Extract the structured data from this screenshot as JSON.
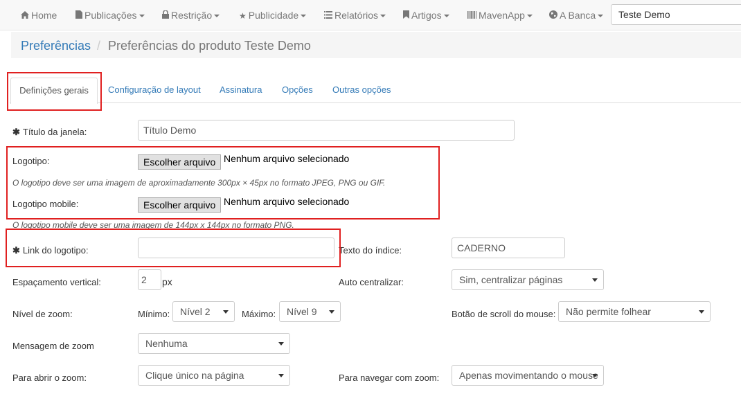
{
  "nav": {
    "home": "Home",
    "publicacoes": "Publicações",
    "restricao": "Restrição",
    "publicidade": "Publicidade",
    "relatorios": "Relatórios",
    "artigos": "Artigos",
    "mavenapp": "MavenApp",
    "abanca": "A Banca",
    "selected_pub": "Teste Demo"
  },
  "breadcrumb": {
    "link": "Preferências",
    "separator": "/",
    "current": "Preferências do produto Teste Demo"
  },
  "tabs": [
    {
      "label": "Definições gerais",
      "active": true
    },
    {
      "label": "Configuração de layout"
    },
    {
      "label": "Assinatura"
    },
    {
      "label": "Opções"
    },
    {
      "label": "Outras opções"
    }
  ],
  "form": {
    "titulo_label": "Título da janela:",
    "titulo_value": "Título Demo",
    "logotipo_label": "Logotipo:",
    "file_button": "Escolher arquivo",
    "no_file": "Nenhum arquivo selecionado",
    "logotipo_help": "O logotipo deve ser uma imagem de aproximadamente 300px × 45px no formato JPEG, PNG ou GIF.",
    "logotipo_mobile_label": "Logotipo mobile:",
    "logotipo_mobile_help": "O logotipo mobile deve ser uma imagem de 144px x 144px no formato PNG.",
    "link_logotipo_label": "Link do logotipo:",
    "link_logotipo_value": "",
    "texto_indice_label": "Texto do índice:",
    "texto_indice_value": "CADERNO",
    "espacamento_label": "Espaçamento vertical:",
    "espacamento_value": "2",
    "espacamento_unit": "px",
    "auto_centralizar_label": "Auto centralizar:",
    "auto_centralizar_value": "Sim, centralizar páginas",
    "nivel_zoom_label": "Nível de zoom:",
    "minimo_label": "Mínimo:",
    "minimo_value": "Nível 2",
    "maximo_label": "Máximo:",
    "maximo_value": "Nível 9",
    "scroll_label": "Botão de scroll do mouse:",
    "scroll_value": "Não permite folhear",
    "mensagem_zoom_label": "Mensagem de zoom",
    "mensagem_zoom_value": "Nenhuma",
    "abrir_zoom_label": "Para abrir o zoom:",
    "abrir_zoom_value": "Clique único na página",
    "navegar_zoom_label": "Para navegar com zoom:",
    "navegar_zoom_value": "Apenas movimentando o mouse"
  },
  "colors": {
    "link": "#337ab7",
    "highlight": "#e02020"
  },
  "icons": {
    "home": "home-icon",
    "publicacoes": "file-icon",
    "restricao": "lock-icon",
    "publicidade": "star-icon",
    "relatorios": "list-icon",
    "artigos": "bookmark-icon",
    "mavenapp": "barcode-icon",
    "abanca": "globe-icon"
  }
}
